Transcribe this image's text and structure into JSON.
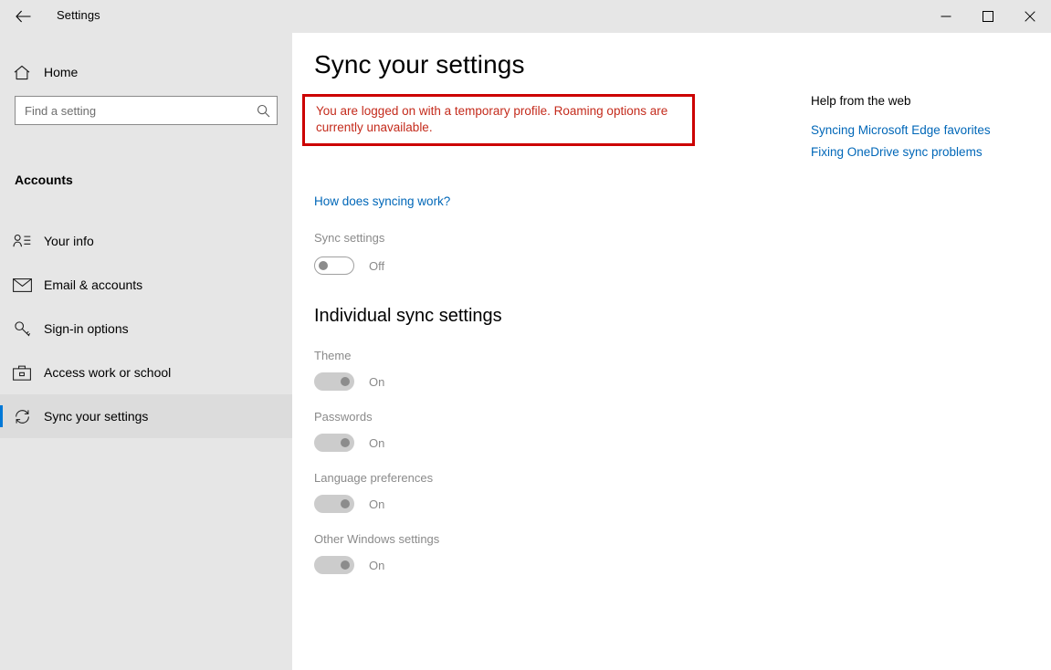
{
  "window": {
    "title": "Settings",
    "back_icon": "back-arrow-icon",
    "minimize_label": "—",
    "maximize_label": "□",
    "close_label": "✕"
  },
  "sidebar": {
    "home_label": "Home",
    "search": {
      "placeholder": "Find a setting",
      "value": ""
    },
    "section_label": "Accounts",
    "items": [
      {
        "label": "Your info",
        "icon": "user-card-icon",
        "selected": false
      },
      {
        "label": "Email & accounts",
        "icon": "envelope-icon",
        "selected": false
      },
      {
        "label": "Sign-in options",
        "icon": "key-icon",
        "selected": false
      },
      {
        "label": "Access work or school",
        "icon": "briefcase-icon",
        "selected": false
      },
      {
        "label": "Sync your settings",
        "icon": "sync-refresh-icon",
        "selected": true
      }
    ]
  },
  "main": {
    "page_title": "Sync your settings",
    "warning": {
      "text": "You are logged on with a temporary profile. Roaming options are currently unavailable.",
      "border_color": "#cc0000",
      "text_color": "#c42b1c"
    },
    "sync_link": "How does syncing work?",
    "sync_settings": {
      "label": "Sync settings",
      "state": "Off",
      "enabled": false
    },
    "individual_heading": "Individual sync settings",
    "individual_settings": [
      {
        "label": "Theme",
        "state": "On"
      },
      {
        "label": "Passwords",
        "state": "On"
      },
      {
        "label": "Language preferences",
        "state": "On"
      },
      {
        "label": "Other Windows settings",
        "state": "On"
      }
    ]
  },
  "help": {
    "title": "Help from the web",
    "links": [
      "Syncing Microsoft Edge favorites",
      "Fixing OneDrive sync problems"
    ]
  },
  "colors": {
    "accent": "#0078d7",
    "link": "#0067b8",
    "sidebar_bg": "#e6e6e6",
    "warning": "#cc0000"
  }
}
